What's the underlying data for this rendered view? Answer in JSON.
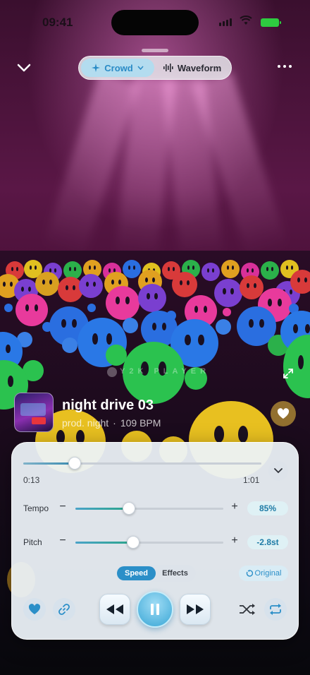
{
  "status_bar": {
    "time": "09:41"
  },
  "view_modes": {
    "crowd_label": "Crowd",
    "waveform_label": "Waveform",
    "active": "crowd"
  },
  "watermark": "Y2K PLAYER",
  "track": {
    "title": "night drive 03",
    "artist": "prod. night",
    "separator": "·",
    "bpm": "109 BPM"
  },
  "playback": {
    "elapsed": "0:13",
    "total": "1:01",
    "progress_fraction": 0.216
  },
  "tempo": {
    "label": "Tempo",
    "minus": "−",
    "plus": "+",
    "value": "85%",
    "level_fraction": 0.36
  },
  "pitch": {
    "label": "Pitch",
    "minus": "−",
    "plus": "+",
    "value": "-2.8st",
    "level_fraction": 0.39
  },
  "mode_tabs": {
    "speed": "Speed",
    "effects": "Effects",
    "active": "speed"
  },
  "original_button": "Original",
  "colors": {
    "accent": "#2b8fc8",
    "accent_light": "#b3dcef",
    "panel_bg": "#ecf2f8",
    "play_button": "#3aa7d6",
    "heart": "#2b8fc8"
  },
  "icons": {
    "crowd": "sparkle-icon",
    "waveform": "waveform-icon",
    "rewind": "rewind-icon",
    "pause": "pause-icon",
    "forward": "fast-forward-icon",
    "shuffle": "shuffle-icon",
    "repeat": "repeat-icon",
    "favorite": "heart-icon",
    "link": "link-icon"
  }
}
